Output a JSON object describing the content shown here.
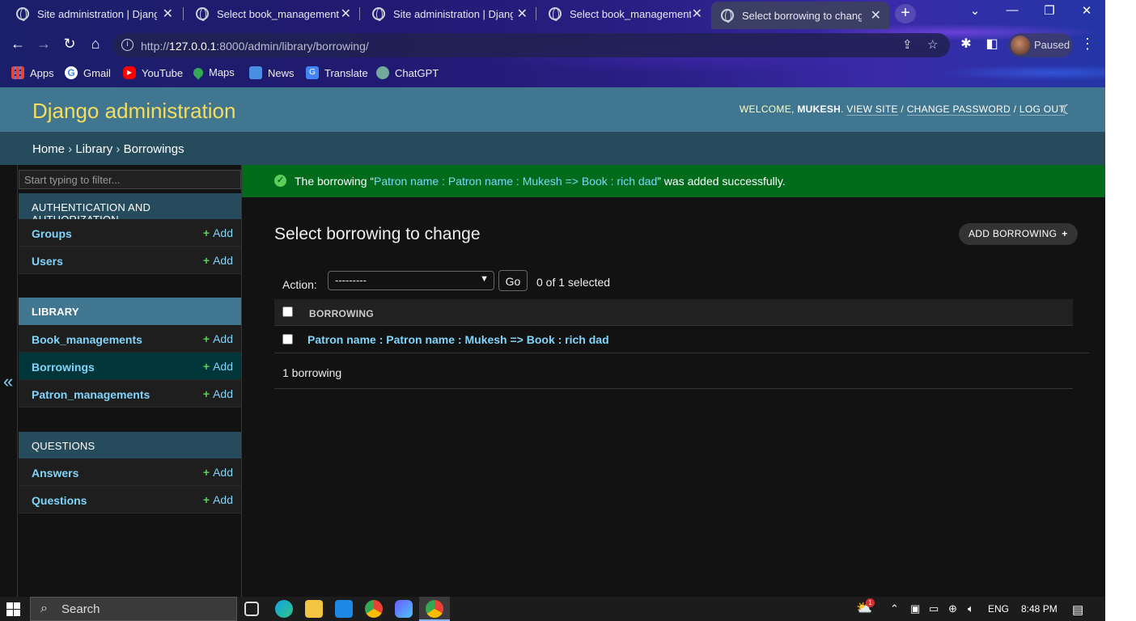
{
  "browser": {
    "tabs": [
      {
        "title": "Site administration | Django",
        "active": false
      },
      {
        "title": "Select book_management to",
        "active": false
      },
      {
        "title": "Site administration | Django",
        "active": false
      },
      {
        "title": "Select book_management to",
        "active": false
      },
      {
        "title": "Select borrowing to change",
        "active": true
      }
    ],
    "url_prefix": "http://",
    "url_host": "127.0.0.1",
    "url_rest": ":8000/admin/library/borrowing/",
    "profile_status": "Paused",
    "bookmarks": [
      {
        "label": "Apps",
        "icon": "apps-grid-icon",
        "color": "#4285f4"
      },
      {
        "label": "Gmail",
        "icon": "google-g-icon",
        "color": "#ea4335"
      },
      {
        "label": "YouTube",
        "icon": "youtube-icon",
        "color": "#ff0000"
      },
      {
        "label": "Maps",
        "icon": "maps-pin-icon",
        "color": "#34a853"
      },
      {
        "label": "News",
        "icon": "news-icon",
        "color": "#4a90e2"
      },
      {
        "label": "Translate",
        "icon": "translate-icon",
        "color": "#4285f4"
      },
      {
        "label": "ChatGPT",
        "icon": "chatgpt-icon",
        "color": "#74aa9c"
      }
    ]
  },
  "admin": {
    "branding": "Django administration",
    "welcome": "WELCOME,",
    "username": "MUKESH",
    "view_site": "VIEW SITE",
    "change_password": "CHANGE PASSWORD",
    "log_out": "LOG OUT",
    "breadcrumbs": [
      "Home",
      "Library",
      "Borrowings"
    ],
    "filter_placeholder": "Start typing to filter...",
    "add_label": "Add",
    "apps": [
      {
        "caption": "AUTHENTICATION AND AUTHORIZATION",
        "models": [
          "Groups",
          "Users"
        ]
      },
      {
        "caption": "LIBRARY",
        "models": [
          "Book_managements",
          "Borrowings",
          "Patron_managements"
        ]
      },
      {
        "caption": "QUESTIONS",
        "models": [
          "Answers",
          "Questions"
        ]
      }
    ],
    "collapse_glyph": "«",
    "message": {
      "prefix": "The borrowing “",
      "object": "Patron name : Patron name : Mukesh => Book : rich dad",
      "suffix": "” was added successfully."
    },
    "page_title": "Select borrowing to change",
    "add_button": "ADD BORROWING",
    "action_label": "Action:",
    "action_value": "---------",
    "go_button": "Go",
    "selected_count": "0 of 1 selected",
    "column_header": "BORROWING",
    "rows": [
      "Patron name : Patron name : Mukesh => Book : rich dad"
    ],
    "paginator": "1 borrowing"
  },
  "taskbar": {
    "search_label": "Search",
    "language": "ENG",
    "time": "8:48 PM",
    "notification_count": "1"
  }
}
